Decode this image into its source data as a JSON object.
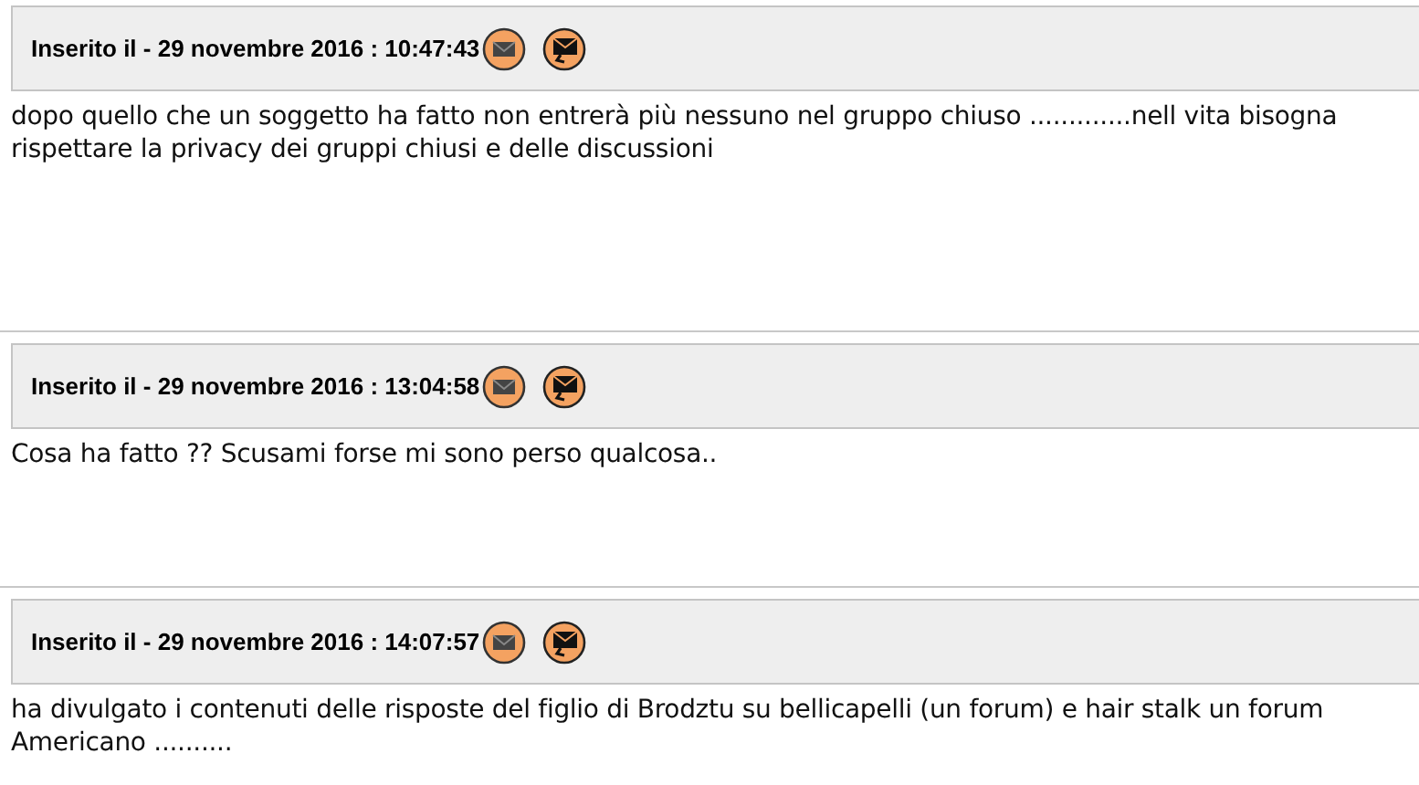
{
  "posts": [
    {
      "header": "Inserito il - 29 novembre 2016 : 10:47:43",
      "body": "dopo quello che un soggetto ha fatto non entrerà più nessuno nel gruppo chiuso .............nell vita bisogna rispettare la privacy dei gruppi chiusi e delle discussioni"
    },
    {
      "header": "Inserito il - 29 novembre 2016 : 13:04:58",
      "body": "Cosa ha fatto ?? Scusami forse mi sono perso qualcosa.."
    },
    {
      "header": "Inserito il - 29 novembre 2016 : 14:07:57",
      "body": "ha divulgato i contenuti delle risposte del figlio di Brodztu su bellicapelli (un forum) e hair stalk un forum Americano .........."
    }
  ]
}
